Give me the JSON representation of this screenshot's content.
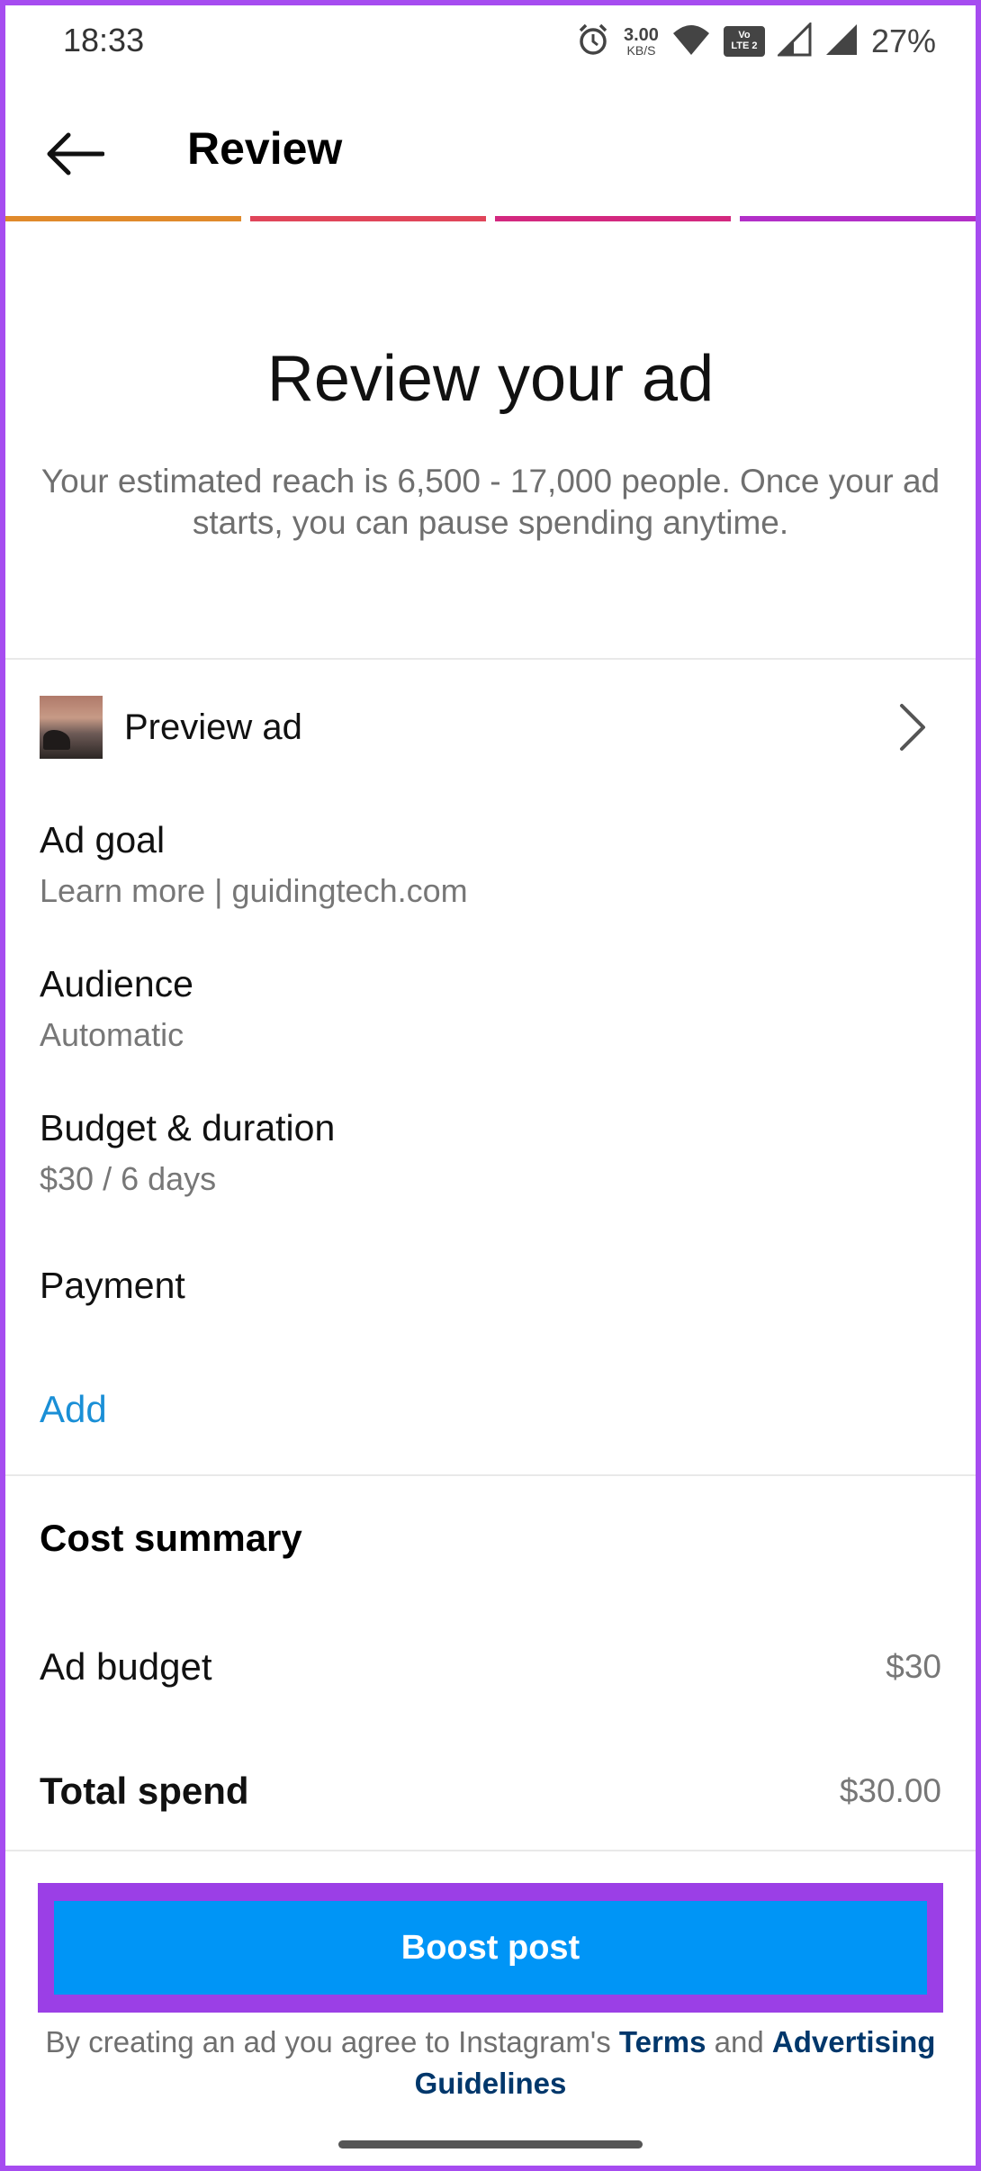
{
  "status_bar": {
    "time": "18:33",
    "speed_value": "3.00",
    "speed_unit": "KB/S",
    "lte_line1": "Vo",
    "lte_line2": "LTE 2",
    "battery": "27%"
  },
  "header": {
    "title": "Review"
  },
  "progress": {
    "colors": [
      "#e08a2c",
      "#e0455a",
      "#d3287f",
      "#b22fc8"
    ]
  },
  "hero": {
    "title": "Review your ad",
    "subtitle": "Your estimated reach is 6,500 - 17,000 people. Once your ad starts, you can pause spending anytime."
  },
  "preview": {
    "label": "Preview ad"
  },
  "details": {
    "ad_goal": {
      "title": "Ad goal",
      "value": "Learn more | guidingtech.com"
    },
    "audience": {
      "title": "Audience",
      "value": "Automatic"
    },
    "budget": {
      "title": "Budget & duration",
      "value": "$30 / 6 days"
    },
    "payment": {
      "title": "Payment"
    },
    "add_label": "Add"
  },
  "cost_summary": {
    "title": "Cost summary",
    "ad_budget_label": "Ad budget",
    "ad_budget_value": "$30",
    "total_label": "Total spend",
    "total_value": "$30.00"
  },
  "boost": {
    "label": "Boost post"
  },
  "legal": {
    "prefix": "By creating an ad you agree to Instagram's",
    "terms": "Terms",
    "and": "and",
    "guidelines": "Advertising Guidelines"
  },
  "colors": {
    "accent": "#0095f6",
    "link": "#1a8fd6",
    "highlight": "#9b3fe6"
  }
}
